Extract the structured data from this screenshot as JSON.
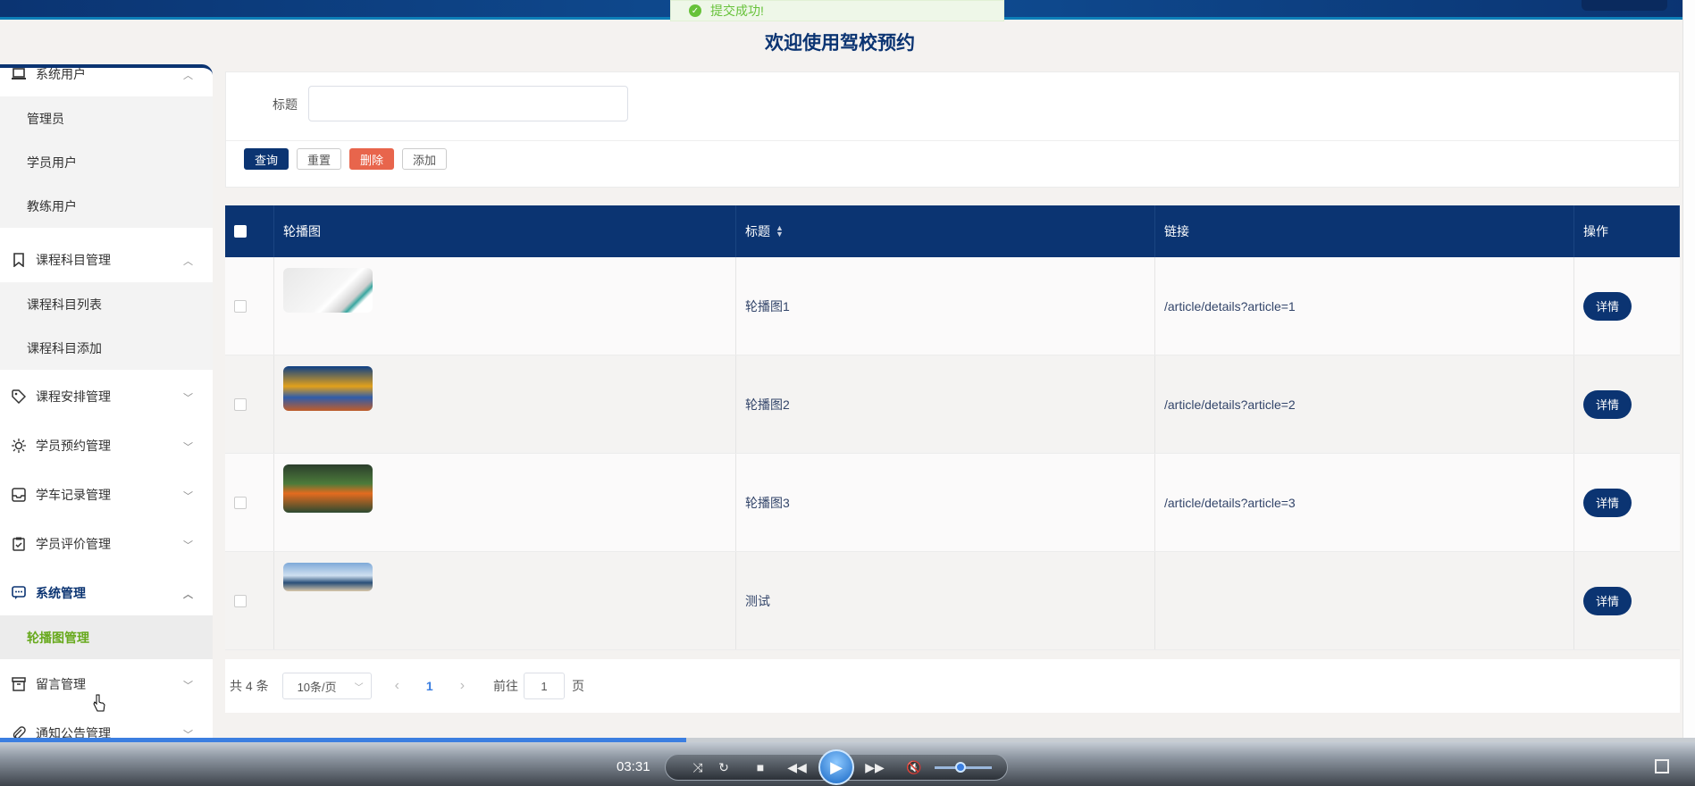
{
  "toast": {
    "text": "提交成功!"
  },
  "page_title": "欢迎使用驾校预约",
  "sidebar": {
    "groups": [
      {
        "label": "系统用户",
        "icon": "laptop-icon",
        "expanded": true,
        "items": [
          "管理员",
          "学员用户",
          "教练用户"
        ]
      },
      {
        "label": "课程科目管理",
        "icon": "bookmark-icon",
        "expanded": true,
        "items": [
          "课程科目列表",
          "课程科目添加"
        ]
      },
      {
        "label": "课程安排管理",
        "icon": "tag-icon",
        "expanded": false,
        "items": []
      },
      {
        "label": "学员预约管理",
        "icon": "sun-icon",
        "expanded": false,
        "items": []
      },
      {
        "label": "学车记录管理",
        "icon": "inbox-icon",
        "expanded": false,
        "items": []
      },
      {
        "label": "学员评价管理",
        "icon": "clipboard-check-icon",
        "expanded": false,
        "items": []
      },
      {
        "label": "系统管理",
        "icon": "message-icon",
        "expanded": true,
        "active": true,
        "items": [
          "轮播图管理"
        ]
      },
      {
        "label": "留言管理",
        "icon": "archive-icon",
        "expanded": false,
        "items": []
      },
      {
        "label": "通知公告管理",
        "icon": "paperclip-icon",
        "expanded": false,
        "items": []
      }
    ],
    "active_item": "轮播图管理"
  },
  "search": {
    "label": "标题",
    "value": "",
    "placeholder": ""
  },
  "buttons": {
    "query": "查询",
    "reset": "重置",
    "delete": "删除",
    "add": "添加"
  },
  "table": {
    "columns": [
      "轮播图",
      "标题",
      "链接",
      "操作"
    ],
    "rows": [
      {
        "title": "轮播图1",
        "link": "/article/details?article=1",
        "action": "详情"
      },
      {
        "title": "轮播图2",
        "link": "/article/details?article=2",
        "action": "详情"
      },
      {
        "title": "轮播图3",
        "link": "/article/details?article=3",
        "action": "详情"
      },
      {
        "title": "测试",
        "link": "",
        "action": "详情"
      }
    ]
  },
  "pagination": {
    "total": "共 4 条",
    "page_size": "10条/页",
    "current": "1",
    "goto_label": "前往",
    "goto_value": "1",
    "goto_suffix": "页"
  },
  "player": {
    "time": "03:31",
    "progress": 0.405,
    "volume": 0.45
  },
  "colors": {
    "primary": "#0b3472",
    "danger": "#e8654c",
    "success": "#67c23a",
    "active_menu": "#67a91c"
  }
}
